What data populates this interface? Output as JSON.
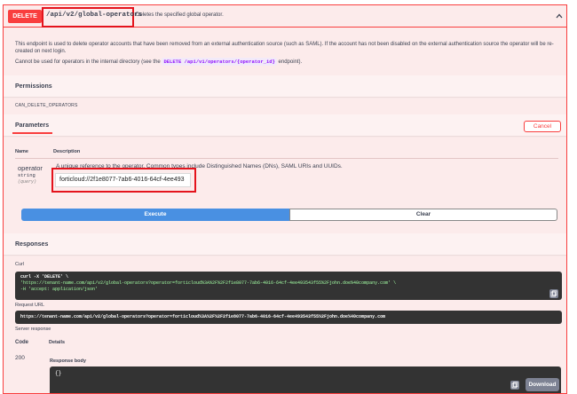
{
  "operation": {
    "method": "DELETE",
    "path": "/api/v2/global-operators",
    "summary": "Deletes the specified global operator.",
    "collapse_icon": "chevron-up-icon"
  },
  "description": {
    "paragraph1": "This endpoint is used to delete operator accounts that have been removed from an external authentication source (such as SAML). If the account has not been disabled on the external authentication source the operator will be re-created on next login.",
    "paragraph2_prefix": "Cannot be used for operators in the internal directory (see the",
    "paragraph2_code": "DELETE /api/v1/operators/{operator_id}",
    "paragraph2_suffix": "endpoint)."
  },
  "permissions": {
    "title": "Permissions",
    "value": "CAN_DELETE_OPERATORS"
  },
  "parameters": {
    "title": "Parameters",
    "cancel_label": "Cancel",
    "col_name": "Name",
    "col_description": "Description",
    "items": [
      {
        "name": "operator",
        "type": "string",
        "location": "(query)",
        "description": "A unique reference to the operator. Common types include Distinguished Names (DNs), SAML URIs and UUIDs.",
        "value": "forticloud://2f1e8077-7ab6-4016-64cf-4ee493"
      }
    ],
    "execute_label": "Execute",
    "clear_label": "Clear"
  },
  "responses": {
    "title": "Responses",
    "curl_label": "Curl",
    "curl_lines": [
      "curl -X 'DELETE' \\",
      "  'https://tenant-name.com/api/v2/global-operators?operator=forticloud%3A%2F%2F2f1e8077-7ab6-4016-64cf-4ee493543f55%2Fjohn.doe%40company.com' \\",
      "  -H 'accept: application/json'"
    ],
    "request_url_label": "Request URL",
    "request_url": "https://tenant-name.com/api/v2/global-operators?operator=forticloud%3A%2F%2F2f1e8077-7ab6-4016-64cf-4ee493543f55%2Fjohn.doe%40company.com",
    "server_response_label": "Server response",
    "col_code": "Code",
    "col_details": "Details",
    "code": "200",
    "response_body_label": "Response body",
    "response_body": "{}",
    "download_label": "Download"
  },
  "colors": {
    "delete_accent": "#f93e3e",
    "execute_blue": "#4990e2",
    "highlight_red": "#e4131c",
    "panel_bg": "#fcebeb",
    "code_bg": "#333333"
  }
}
